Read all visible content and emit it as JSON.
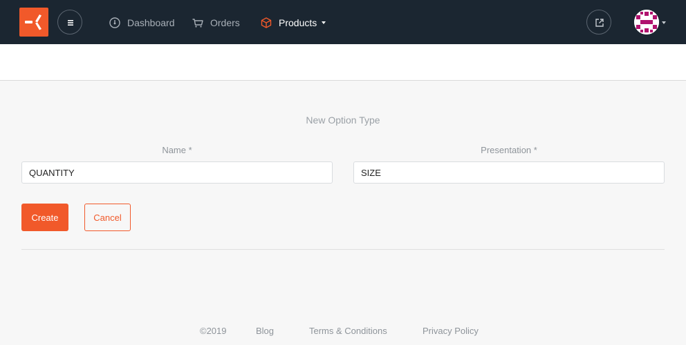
{
  "header": {
    "logo_icon": "pinwheel-logo-icon",
    "menu_icon": "hamburger-menu-icon",
    "nav": [
      {
        "label": "Dashboard",
        "icon": "speedometer-icon"
      },
      {
        "label": "Orders",
        "icon": "cart-icon"
      },
      {
        "label": "Products",
        "icon": "box-icon",
        "active": true
      }
    ],
    "external_icon": "external-link-icon",
    "colors": {
      "background": "#1b2631",
      "accent": "#f1592a"
    }
  },
  "form": {
    "title": "New Option Type",
    "name_label": "Name *",
    "name_value": "QUANTITY",
    "presentation_label": "Presentation *",
    "presentation_value": "SIZE",
    "create_label": "Create",
    "cancel_label": "Cancel"
  },
  "footer": {
    "copyright": "©2019",
    "blog": "Blog",
    "terms": "Terms & Conditions",
    "privacy": "Privacy Policy"
  }
}
